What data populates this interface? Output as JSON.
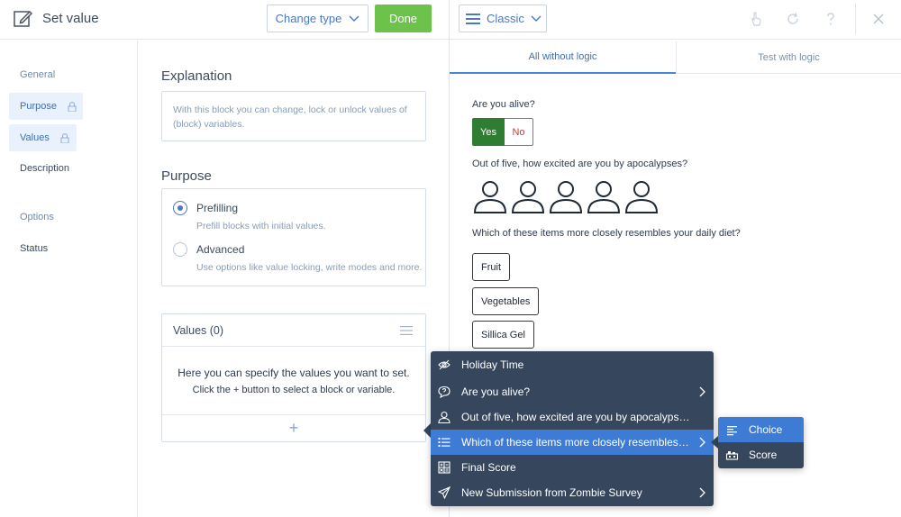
{
  "header": {
    "title": "Set value",
    "change_type_label": "Change type",
    "done_label": "Done",
    "preview_mode_label": "Classic"
  },
  "sidebar": {
    "groups": [
      {
        "label": "General"
      },
      {
        "label": "Options"
      }
    ],
    "items": [
      {
        "label": "Purpose",
        "locked": true,
        "active": true
      },
      {
        "label": "Values",
        "locked": true,
        "active": true
      },
      {
        "label": "Description",
        "locked": false,
        "active": false
      },
      {
        "label": "Status",
        "locked": false,
        "active": false
      }
    ]
  },
  "explanation": {
    "title": "Explanation",
    "text": "With this block you can change, lock or unlock values of (block) variables."
  },
  "purpose": {
    "title": "Purpose",
    "options": [
      {
        "title": "Prefilling",
        "desc": "Prefill blocks with initial values.",
        "selected": true
      },
      {
        "title": "Advanced",
        "desc": "Use options like value locking, write modes and more.",
        "selected": false
      }
    ]
  },
  "values": {
    "title": "Values (0)",
    "empty_line1": "Here you can specify the values you want to set.",
    "empty_line2": "Click the + button to select a block or variable.",
    "add_symbol": "+"
  },
  "preview": {
    "tabs": [
      {
        "label": "All without logic",
        "active": true
      },
      {
        "label": "Test with logic",
        "active": false
      }
    ],
    "questions": [
      {
        "text": "Are you alive?",
        "yes": "Yes",
        "no": "No"
      },
      {
        "text": "Out of five, how excited are you by apocalypses?",
        "rating_max": 5
      },
      {
        "text": "Which of these items more closely resembles your daily diet?",
        "choices": [
          "Fruit",
          "Vegetables",
          "Sillica Gel"
        ]
      }
    ]
  },
  "menu": {
    "items": [
      {
        "icon": "eye-slash-icon",
        "label": "Holiday Time",
        "has_submenu": false,
        "highlighted": false
      },
      {
        "icon": "speech-bubble-icon",
        "label": "Are you alive?",
        "has_submenu": true,
        "highlighted": false
      },
      {
        "icon": "person-icon",
        "label": "Out of five, how excited are you by apocalypses?",
        "has_submenu": false,
        "highlighted": false
      },
      {
        "icon": "list-icon",
        "label": "Which of these items more closely resembles your daily diet?",
        "has_submenu": true,
        "highlighted": true
      },
      {
        "icon": "calculator-icon",
        "label": "Final Score",
        "has_submenu": false,
        "highlighted": false
      },
      {
        "icon": "paper-plane-icon",
        "label": "New Submission from Zombie Survey",
        "has_submenu": true,
        "highlighted": false
      }
    ],
    "submenu": [
      {
        "icon": "lines-icon",
        "label": "Choice",
        "highlighted": true
      },
      {
        "icon": "score-icon",
        "label": "Score",
        "highlighted": false
      }
    ]
  },
  "colors": {
    "accent": "#4a78c2",
    "done_green": "#6cc24a",
    "yes_green": "#2f7d32",
    "no_red": "#d9534f",
    "menu_bg": "#36465c",
    "menu_highlight": "#3d7bd4"
  }
}
